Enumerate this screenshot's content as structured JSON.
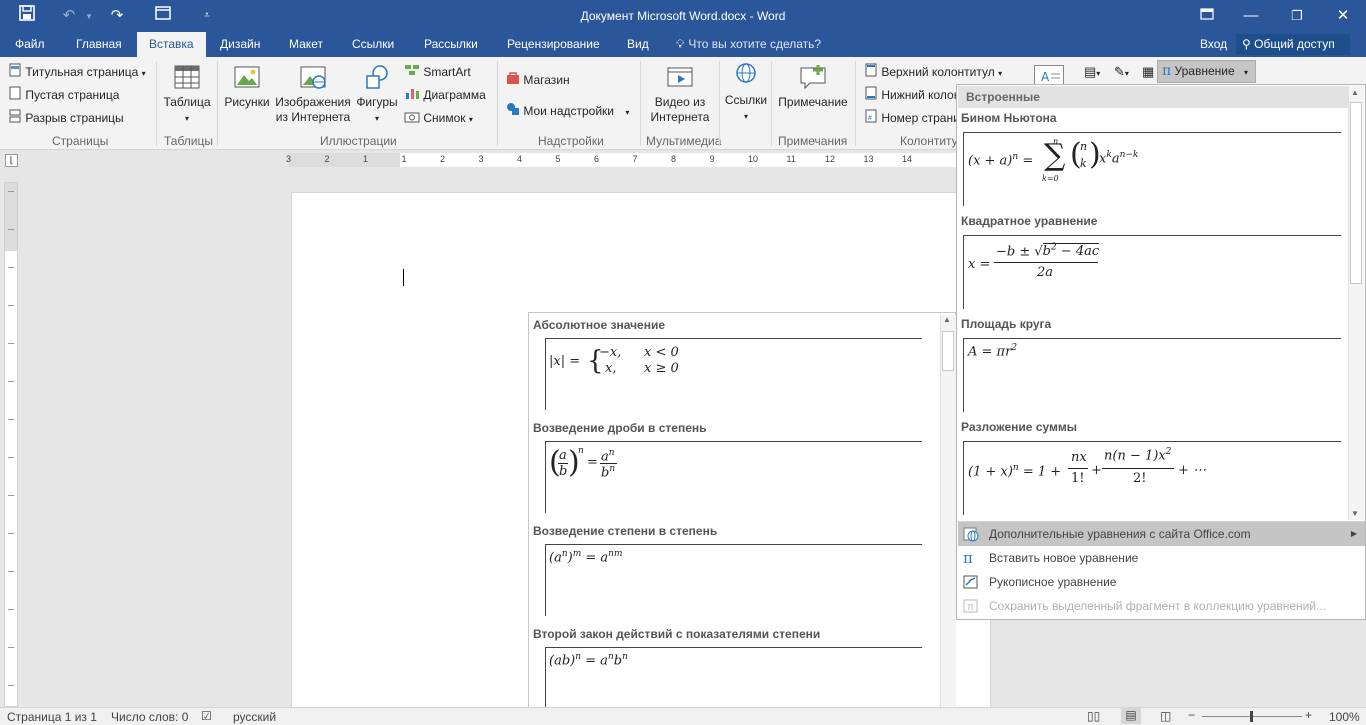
{
  "window": {
    "title": "Документ Microsoft Word.docx - Word"
  },
  "tabs": {
    "file": "Файл",
    "items": [
      "Главная",
      "Вставка",
      "Дизайн",
      "Макет",
      "Ссылки",
      "Рассылки",
      "Рецензирование",
      "Вид"
    ],
    "active": "Вставка",
    "tell_me": "Что вы хотите сделать?",
    "signin": "Вход",
    "share": "Общий доступ"
  },
  "ribbon": {
    "pages": {
      "cover": "Титульная страница",
      "blank": "Пустая страница",
      "break": "Разрыв страницы",
      "label": "Страницы"
    },
    "tables": {
      "table": "Таблица",
      "label": "Таблицы"
    },
    "illustrations": {
      "pictures": "Рисунки",
      "online1": "Изображения",
      "online2": "из Интернета",
      "shapes": "Фигуры",
      "smartart": "SmartArt",
      "chart": "Диаграмма",
      "screenshot": "Снимок",
      "label": "Иллюстрации"
    },
    "addins": {
      "store": "Магазин",
      "myaddins": "Мои надстройки",
      "label": "Надстройки"
    },
    "media": {
      "video1": "Видео из",
      "video2": "Интернета",
      "label": "Мультимедиа"
    },
    "links": {
      "links": "Ссылки"
    },
    "comments": {
      "comment": "Примечание",
      "label": "Примечания"
    },
    "headerfooter": {
      "header": "Верхний колонтитул",
      "footer": "Нижний колонтитул",
      "pagenum": "Номер страницы",
      "label": "Колонтитулы"
    },
    "equation": "Уравнение"
  },
  "ruler": {
    "numbers": [
      "3",
      "2",
      "1",
      "1",
      "2",
      "3",
      "4",
      "5",
      "6",
      "7",
      "8",
      "9",
      "10",
      "11",
      "12",
      "13",
      "14"
    ]
  },
  "builtin_gallery": {
    "header": "Встроенные",
    "items": [
      {
        "title": "Бином Ньютона"
      },
      {
        "title": "Квадратное уравнение"
      },
      {
        "title": "Площадь круга"
      },
      {
        "title": "Разложение суммы"
      }
    ]
  },
  "office_gallery": {
    "items": [
      {
        "title": "Абсолютное значение"
      },
      {
        "title": "Возведение дроби в степень"
      },
      {
        "title": "Возведение степени в степень"
      },
      {
        "title": "Второй закон действий с показателями степени"
      }
    ]
  },
  "menu": {
    "more": "Дополнительные уравнения с сайта Office.com",
    "insert_new": "Вставить новое уравнение",
    "ink": "Рукописное уравнение",
    "save": "Сохранить выделенный фрагмент в коллекцию уравнений..."
  },
  "status": {
    "page": "Страница 1 из 1",
    "words": "Число слов: 0",
    "lang": "русский",
    "zoom": "100%"
  },
  "colors": {
    "brand": "#2b579a",
    "highlight": "#c5c5c5"
  }
}
